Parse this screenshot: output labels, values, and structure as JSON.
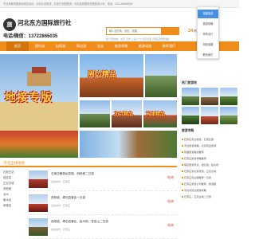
{
  "topbar": {
    "text": "专业承接到国各地旅游活动，河北北京旅游，石家庄到国旅游，河北旅游服务到国旅游公司，电话：0311-86668698"
  },
  "header": {
    "logo_emblem": "旅",
    "logo_name": "河北东方国际旅行社",
    "logo_sub": "Hebei Orient International Travel Agency",
    "phone_label": "电话/微信：",
    "phone_number": "13722865035",
    "search_placeholder": "输入目的地、景区、线路",
    "search_button_label": "",
    "hot_text": "热门目的地：北京  天津  上海  广州  北京北至  石家庄旅游线路",
    "right_big": "24",
    "right_small": "热线"
  },
  "nav": {
    "items": [
      {
        "label": "首页",
        "active": true
      },
      {
        "label": "国内游",
        "active": false
      },
      {
        "label": "出境游",
        "active": false
      },
      {
        "label": "周边游",
        "active": false
      },
      {
        "label": "会议",
        "active": false
      },
      {
        "label": "旅游攻略",
        "active": false
      },
      {
        "label": "旅游动态",
        "active": false
      },
      {
        "label": "联系我们",
        "active": false
      }
    ]
  },
  "dropdown": {
    "items": [
      {
        "label": "抱团旅游",
        "active": true
      },
      {
        "label": "旅游攻略",
        "active": false
      },
      {
        "label": "驾车出行",
        "active": false
      },
      {
        "label": "特色线路",
        "active": false
      },
      {
        "label": "联系我们",
        "active": false
      }
    ]
  },
  "banner": {
    "title": "地接专版"
  },
  "grid": {
    "photos": [
      {
        "title": "周边精品"
      },
      {
        "title": ""
      },
      {
        "title": ""
      },
      {
        "title": "北京精品"
      },
      {
        "title": "天津精品"
      },
      {
        "title": ""
      }
    ]
  },
  "section": {
    "title": "河北全线地接"
  },
  "side_list": {
    "rows": [
      {
        "label": "石家庄站"
      },
      {
        "label": "保定站"
      },
      {
        "label": "正定古城"
      },
      {
        "label": "西柏坡"
      },
      {
        "label": "沧州"
      },
      {
        "label": "衡水站"
      },
      {
        "label": "承德站"
      }
    ]
  },
  "routes": [
    {
      "title": "石家庄解放纪念馆、西柏坡二日游",
      "meta": "出发城市：石家庄",
      "price": "电询"
    },
    {
      "title": "西柏坡、嶂石岩景区一日游",
      "meta": "出发城市：石家庄",
      "price": "电询"
    },
    {
      "title": "西柏坡、嶂石岩景区、赵州桥、苍岩山二日游",
      "meta": "出发城市：石家庄",
      "price": "电询"
    }
  ],
  "right_col": {
    "head1": "热门旅游地",
    "head2": "旅游攻略",
    "articles": [
      {
        "title": "石家庄周边旅游，石家庄旅"
      },
      {
        "title": "河北旅游攻略，北京周边旅游"
      },
      {
        "title": "到国旅游路线推荐"
      },
      {
        "title": "石家庄旅游攻略推荐"
      },
      {
        "title": "保定旅游景点，嶂石岩、赵州桥"
      },
      {
        "title": "石家庄到北京旅游，正定古城"
      },
      {
        "title": "石家庄周边游推荐一日游"
      },
      {
        "title": "石家庄旅游公司推荐，旅游团"
      },
      {
        "title": "河北省周边旅游攻略"
      },
      {
        "title": "石家庄，正定古城二日游"
      }
    ]
  },
  "colors": {
    "accent": "#f08c1a",
    "nav_active": "#d4740a",
    "price": "#e4393c",
    "dropdown_active": "#4a90e2"
  }
}
